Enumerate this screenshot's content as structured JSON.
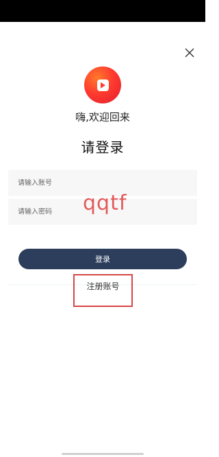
{
  "welcome_text": "嗨,欢迎回来",
  "title": "请登录",
  "account_field": {
    "placeholder": "请输入账号"
  },
  "password_field": {
    "placeholder": "请输入密码"
  },
  "login_button": {
    "label": "登录"
  },
  "register_link": {
    "label": "注册账号"
  },
  "watermark_text": "qqtf",
  "colors": {
    "primary_button": "#2c3e5c",
    "logo_red": "#ff3b2f",
    "highlight_box": "#d64545"
  },
  "icons": {
    "close": "close-icon",
    "logo": "play-logo-icon"
  }
}
